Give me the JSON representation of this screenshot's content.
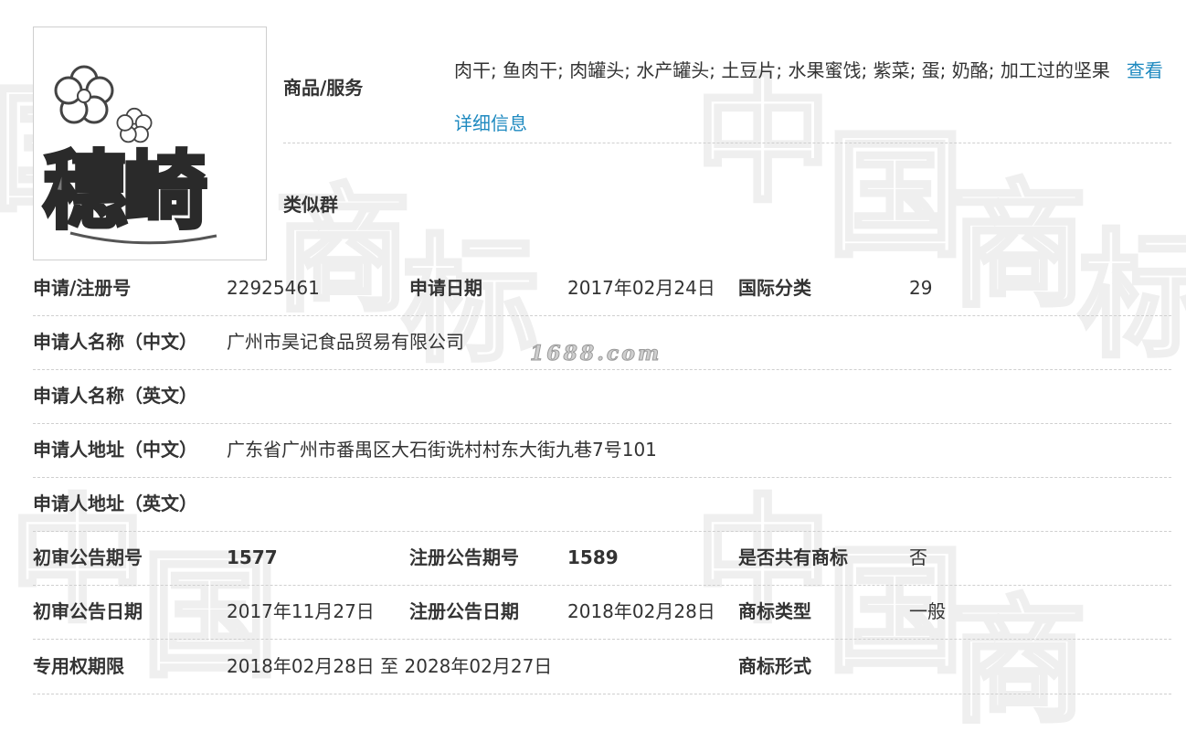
{
  "logo": {
    "mark_text": "穗崎",
    "icons": [
      "flower-icon",
      "flower-icon"
    ]
  },
  "top": {
    "goods_label": "商品/服务",
    "goods_value": "肉干; 鱼肉干; 肉罐头; 水产罐头; 土豆片; 水果蜜饯; 紫菜; 蛋; 奶酪; 加工过的坚果",
    "goods_link": "查看详细信息",
    "similar_label": "类似群",
    "similar_value": ""
  },
  "fields": {
    "reg_no_label": "申请/注册号",
    "reg_no": "22925461",
    "app_date_label": "申请日期",
    "app_date": "2017年02月24日",
    "intl_class_label": "国际分类",
    "intl_class": "29",
    "applicant_cn_label": "申请人名称（中文）",
    "applicant_cn": "广州市昊记食品贸易有限公司",
    "applicant_en_label": "申请人名称（英文）",
    "applicant_en": "",
    "address_cn_label": "申请人地址（中文）",
    "address_cn": "广东省广州市番禺区大石街诜村村东大街九巷7号101",
    "address_en_label": "申请人地址（英文）",
    "address_en": "",
    "prelim_issue_label": "初审公告期号",
    "prelim_issue": "1577",
    "reg_issue_label": "注册公告期号",
    "reg_issue": "1589",
    "shared_label": "是否共有商标",
    "shared": "否",
    "prelim_date_label": "初审公告日期",
    "prelim_date": "2017年11月27日",
    "reg_date_label": "注册公告日期",
    "reg_date": "2018年02月28日",
    "type_label": "商标类型",
    "type": "一般",
    "term_label": "专用权期限",
    "term": "2018年02月28日 至 2028年02月27日",
    "form_label": "商标形式",
    "form": ""
  },
  "watermark": {
    "site": "1688.com",
    "chars": [
      "中",
      "国",
      "商",
      "标"
    ]
  }
}
